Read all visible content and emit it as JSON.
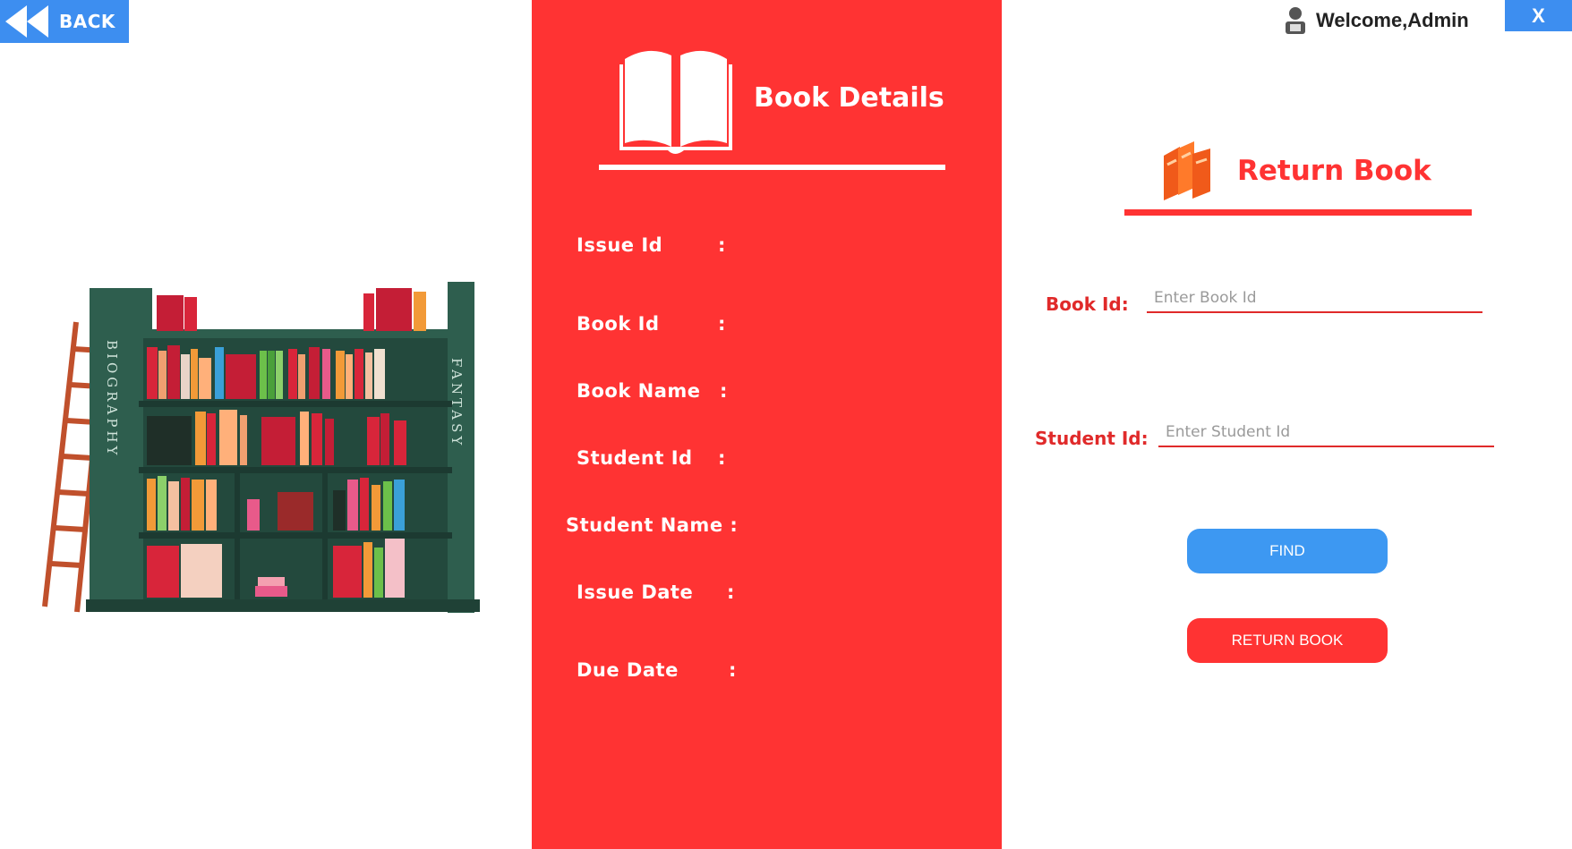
{
  "header": {
    "back_label": "BACK",
    "welcome_text": "Welcome,Admin",
    "close_label": "X"
  },
  "book_details": {
    "title": "Book Details",
    "fields": [
      {
        "label": "Issue Id",
        "colon": ":"
      },
      {
        "label": "Book Id",
        "colon": ":"
      },
      {
        "label": "Book Name",
        "colon": ":"
      },
      {
        "label": "Student Id",
        "colon": ":"
      },
      {
        "label": "Student Name :",
        "colon": ""
      },
      {
        "label": "Issue Date",
        "colon": ":"
      },
      {
        "label": "Due Date",
        "colon": ":"
      }
    ]
  },
  "illustration": {
    "left_spine": "BIOGRAPHY",
    "right_spine": "FANTASY"
  },
  "return_book": {
    "title": "Return Book",
    "book_id_label": "Book Id:",
    "book_id_placeholder": "Enter Book Id",
    "student_id_label": "Student Id:",
    "student_id_placeholder": "Enter Student Id",
    "find_label": "FIND",
    "return_label": "RETURN BOOK"
  },
  "colors": {
    "accent_red": "#ff3333",
    "accent_blue": "#3d8ef0",
    "shelf_green": "#2e5e4e"
  },
  "icons": [
    "rewind-icon",
    "user-icon",
    "open-book-icon",
    "books-icon"
  ]
}
